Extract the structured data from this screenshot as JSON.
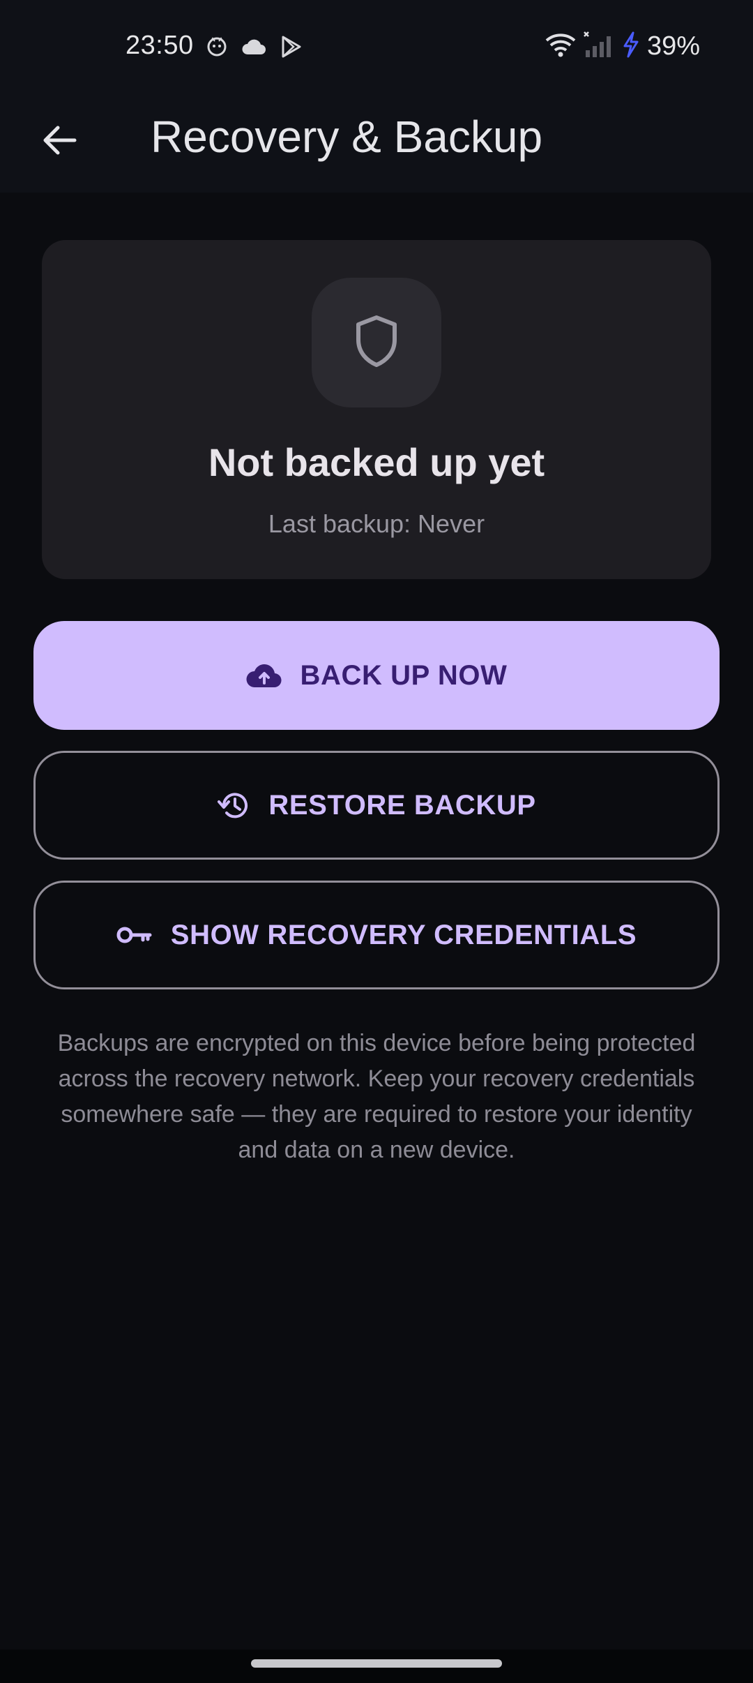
{
  "status_bar": {
    "time": "23:50",
    "left_icons": [
      "cat-face-icon",
      "cloud-icon",
      "play-store-icon"
    ],
    "right_icons": [
      "wifi-icon",
      "cellular-signal-icon",
      "charging-bolt-icon"
    ],
    "battery": "39%"
  },
  "app_bar": {
    "back_icon": "arrow-back-icon",
    "title": "Recovery & Backup"
  },
  "status_card": {
    "icon": "shield-icon",
    "title": "Not backed up yet",
    "subtitle": "Last backup: Never"
  },
  "actions": {
    "backup": {
      "label": "BACK UP NOW",
      "icon": "cloud-upload-icon"
    },
    "restore": {
      "label": "RESTORE BACKUP",
      "icon": "history-icon"
    },
    "credentials": {
      "label": "SHOW RECOVERY CREDENTIALS",
      "icon": "key-icon"
    }
  },
  "info_text": "Backups are encrypted on this device before being protected across the recovery network. Keep your recovery credentials somewhere safe — they are required to restore your identity and data on a new device.",
  "colors": {
    "primary": "#d0bcfe",
    "on_primary": "#381e72",
    "background": "#0b0c10",
    "card": "#1e1d22",
    "charging": "#4a5cff"
  }
}
